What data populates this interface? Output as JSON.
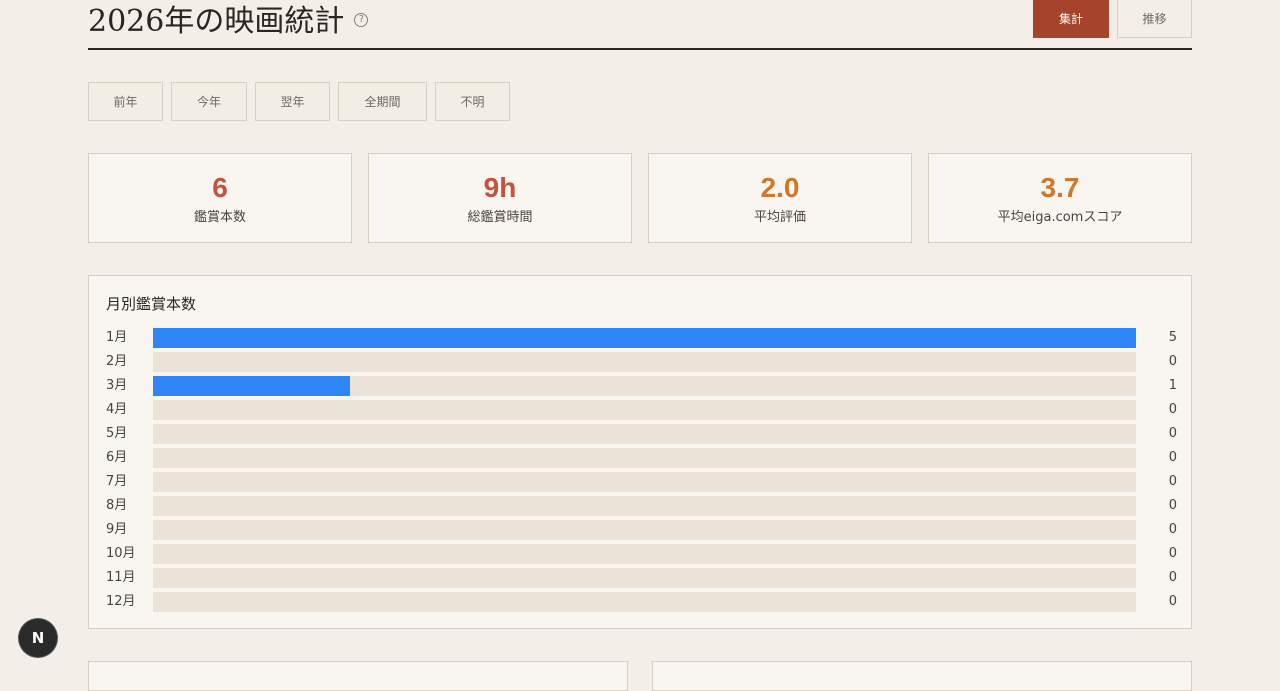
{
  "header": {
    "title": "2026年の映画統計",
    "help_icon": "help-circle-icon",
    "views": [
      {
        "label": "集計",
        "active": true
      },
      {
        "label": "推移",
        "active": false
      }
    ]
  },
  "filters": [
    {
      "label": "前年"
    },
    {
      "label": "今年"
    },
    {
      "label": "翌年"
    },
    {
      "label": "全期間"
    },
    {
      "label": "不明"
    }
  ],
  "stats": [
    {
      "value": "6",
      "label": "鑑賞本数",
      "color": "#c4533b"
    },
    {
      "value": "9h",
      "label": "総鑑賞時間",
      "color": "#c4533b"
    },
    {
      "value": "2.0",
      "label": "平均評価",
      "color": "#d0772a"
    },
    {
      "value": "3.7",
      "label": "平均eiga.comスコア",
      "color": "#d0772a"
    }
  ],
  "chart_data": {
    "type": "bar",
    "title": "月別鑑賞本数",
    "orientation": "horizontal",
    "categories": [
      "1月",
      "2月",
      "3月",
      "4月",
      "5月",
      "6月",
      "7月",
      "8月",
      "9月",
      "10月",
      "11月",
      "12月"
    ],
    "values": [
      5,
      0,
      1,
      0,
      0,
      0,
      0,
      0,
      0,
      0,
      0,
      0
    ],
    "xlim": [
      0,
      5
    ],
    "bar_color": "#2f86f6",
    "track_color": "#ebe3d8"
  },
  "badge": {
    "label": "N",
    "icon": "nextjs-icon"
  }
}
